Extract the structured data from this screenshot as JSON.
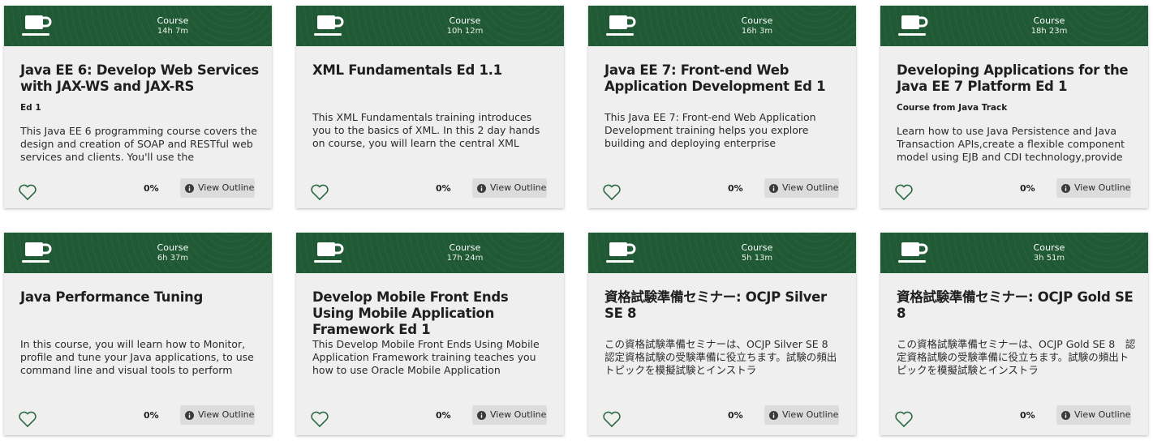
{
  "common": {
    "outline_label": "View Outline",
    "heart_icon": "heart-outline-icon",
    "cup_icon": "coffee-cup-icon",
    "info_icon": "info-circle-icon",
    "header_color": "#205a35",
    "card_bg": "#efefef"
  },
  "cards": [
    {
      "type": "Course",
      "duration": "14h 7m",
      "title": "Java EE 6: Develop Web Services with JAX-WS and JAX-RS",
      "subtitle": "Ed 1",
      "description": "This Java EE 6 programming course covers the design and creation of SOAP and RESTful web services and clients. You'll use the",
      "progress": "0%"
    },
    {
      "type": "Course",
      "duration": "10h 12m",
      "title": "XML Fundamentals Ed 1.1",
      "subtitle": "",
      "description": "This XML Fundamentals training introduces you to the basics of XML. In this 2 day hands on course, you will learn the central XML",
      "progress": "0%"
    },
    {
      "type": "Course",
      "duration": "16h 3m",
      "title": "Java EE 7: Front-end Web Application Development Ed 1",
      "subtitle": "",
      "description": "This Java EE 7: Front-end Web Application Development training helps you explore building and deploying enterprise",
      "progress": "0%"
    },
    {
      "type": "Course",
      "duration": "18h 23m",
      "title": "Developing Applications for the Java EE 7 Platform Ed 1",
      "subtitle": "Course from Java Track",
      "description": "Learn how to use Java Persistence and Java Transaction APIs,create a flexible component model using EJB and CDI technology,provide",
      "progress": "0%"
    },
    {
      "type": "Course",
      "duration": "6h 37m",
      "title": "Java Performance Tuning",
      "subtitle": "",
      "description": "In this course, you will learn how to Monitor, profile and tune your Java applications, to use command line and visual tools to perform",
      "progress": "0%"
    },
    {
      "type": "Course",
      "duration": "17h 24m",
      "title": "Develop Mobile Front Ends Using Mobile Application Framework Ed 1",
      "subtitle": "",
      "description": "This Develop Mobile Front Ends Using Mobile Application Framework training teaches you how to use Oracle Mobile Application",
      "progress": "0%"
    },
    {
      "type": "Course",
      "duration": "5h 13m",
      "title": "資格試験準備セミナー: OCJP Silver SE 8",
      "subtitle": "",
      "description": "この資格試験準備セミナーは、OCJP Silver SE 8　認定資格試験の受験準備に役立ちます。試験の頻出トピックを模擬試験とインストラ",
      "progress": "0%"
    },
    {
      "type": "Course",
      "duration": "3h 51m",
      "title": "資格試験準備セミナー: OCJP Gold SE 8",
      "subtitle": "",
      "description": "この資格試験準備セミナーは、OCJP Gold SE 8　認定資格試験の受験準備に役立ちます。試験の頻出トピックを模擬試験とインストラ",
      "progress": "0%"
    }
  ]
}
